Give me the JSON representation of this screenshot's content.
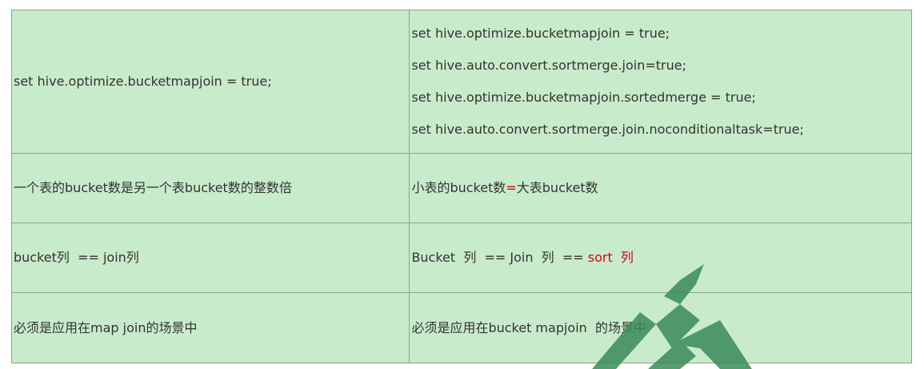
{
  "rows": [
    {
      "left": "set hive.optimize.bucketmapjoin = true;",
      "right_lines": [
        "set hive.optimize.bucketmapjoin = true;",
        "set hive.auto.convert.sortmerge.join=true;",
        "set hive.optimize.bucketmapjoin.sortedmerge = true;",
        "set hive.auto.convert.sortmerge.join.noconditionaltask=true;"
      ]
    },
    {
      "left": "一个表的bucket数是另一个表bucket数的整数倍",
      "right_prefix": "小表的bucket数",
      "right_symbol": "=",
      "right_suffix": "大表bucket数"
    },
    {
      "left": "bucket列  == join列",
      "right_prefix": "Bucket  列  == Join  列  == ",
      "right_highlight": "sort  列"
    },
    {
      "left": "必须是应用在map join的场景中",
      "right": "必须是应用在bucket mapjoin  的场景中"
    }
  ],
  "colors": {
    "cell_background": "#c7ebcb",
    "border": "#8fa18f",
    "text": "#333333",
    "highlight": "#d0021b",
    "watermark": "#3a8a5a"
  }
}
